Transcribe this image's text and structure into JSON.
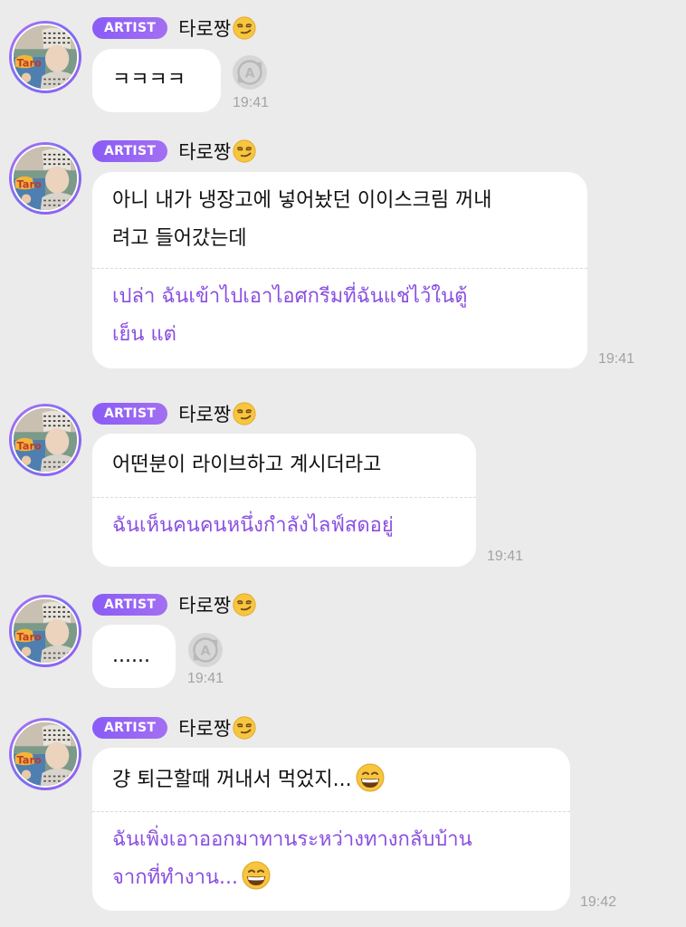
{
  "colors": {
    "background": "#ebebeb",
    "bubble": "#ffffff",
    "badge": "#8a5cf6",
    "translation_text": "#8a4fe0",
    "time_text": "#a3a3a3"
  },
  "messages": [
    {
      "badge": "ARTIST",
      "sender": "타로짱",
      "sender_emoji": "smirking-face-icon",
      "text": "ㅋㅋㅋㅋ",
      "time": "19:41",
      "action_icon": "translate-icon"
    },
    {
      "badge": "ARTIST",
      "sender": "타로짱",
      "sender_emoji": "smirking-face-icon",
      "text_line1": "아니 내가 냉장고에 넣어놨던 이이스크림 꺼내",
      "text_line2": "려고 들어갔는데",
      "translation_line1": "เปล่า ฉันเข้าไปเอาไอศกรีมที่ฉันแช่ไว้ในตู้",
      "translation_line2": "เย็น แต่",
      "time": "19:41"
    },
    {
      "badge": "ARTIST",
      "sender": "타로짱",
      "sender_emoji": "smirking-face-icon",
      "text": "어떤분이 라이브하고 계시더라고",
      "translation": "ฉันเห็นคนคนหนึ่งกำลังไลฟ์สดอยู่",
      "time": "19:41"
    },
    {
      "badge": "ARTIST",
      "sender": "타로짱",
      "sender_emoji": "smirking-face-icon",
      "text": "......",
      "time": "19:41",
      "action_icon": "translate-icon"
    },
    {
      "badge": "ARTIST",
      "sender": "타로짱",
      "sender_emoji": "smirking-face-icon",
      "text": "걍 퇴근할때 꺼내서 먹었지...",
      "text_emoji": "grinning-face-icon",
      "translation_line1": "ฉันเพิ่งเอาออกมาทานระหว่างทางกลับบ้าน",
      "translation_line2": "จากที่ทำงาน...",
      "translation_emoji": "grinning-face-icon",
      "time": "19:42"
    }
  ]
}
